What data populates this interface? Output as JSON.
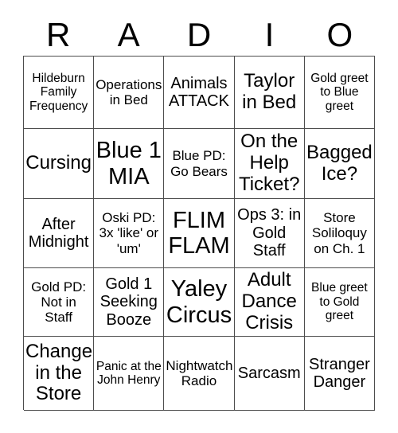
{
  "card": {
    "header_letters": [
      "R",
      "A",
      "D",
      "I",
      "O"
    ],
    "columns": 5,
    "rows": 5,
    "text_color": "#000000",
    "background_color": "#ffffff",
    "border_color": "#4d4d4d",
    "squares": [
      {
        "id": "r1c1",
        "text": "Hildeburn Family Frequency",
        "size": "sm"
      },
      {
        "id": "r1c2",
        "text": "Operations in Bed",
        "size": "md"
      },
      {
        "id": "r1c3",
        "text": "Animals ATTACK",
        "size": "lg"
      },
      {
        "id": "r1c4",
        "text": "Taylor in Bed",
        "size": "xl"
      },
      {
        "id": "r1c5",
        "text": "Gold greet to Blue greet",
        "size": "sm"
      },
      {
        "id": "r2c1",
        "text": "Cursing",
        "size": "xl"
      },
      {
        "id": "r2c2",
        "text": "Blue 1 MIA",
        "size": "xxl"
      },
      {
        "id": "r2c3",
        "text": "Blue PD: Go Bears",
        "size": "md"
      },
      {
        "id": "r2c4",
        "text": "On the Help Ticket?",
        "size": "xl"
      },
      {
        "id": "r2c5",
        "text": "Bagged Ice?",
        "size": "xl"
      },
      {
        "id": "r3c1",
        "text": "After Midnight",
        "size": "lg"
      },
      {
        "id": "r3c2",
        "text": "Oski PD: 3x 'like' or 'um'",
        "size": "md"
      },
      {
        "id": "r3c3",
        "text": "FLIM FLAM",
        "size": "xxl"
      },
      {
        "id": "r3c4",
        "text": "Ops 3: in Gold Staff",
        "size": "lg"
      },
      {
        "id": "r3c5",
        "text": "Store Soliloquy on Ch. 1",
        "size": "md"
      },
      {
        "id": "r4c1",
        "text": "Gold PD: Not in Staff",
        "size": "md"
      },
      {
        "id": "r4c2",
        "text": "Gold 1 Seeking Booze",
        "size": "lg"
      },
      {
        "id": "r4c3",
        "text": "Yaley Circus",
        "size": "xxl"
      },
      {
        "id": "r4c4",
        "text": "Adult Dance Crisis",
        "size": "xl"
      },
      {
        "id": "r4c5",
        "text": "Blue greet to Gold greet",
        "size": "sm"
      },
      {
        "id": "r5c1",
        "text": "Change in the Store",
        "size": "xl"
      },
      {
        "id": "r5c2",
        "text": "Panic at the John Henry",
        "size": "sm"
      },
      {
        "id": "r5c3",
        "text": "Nightwatch Radio",
        "size": "md"
      },
      {
        "id": "r5c4",
        "text": "Sarcasm",
        "size": "lg"
      },
      {
        "id": "r5c5",
        "text": "Stranger Danger",
        "size": "lg"
      }
    ]
  }
}
